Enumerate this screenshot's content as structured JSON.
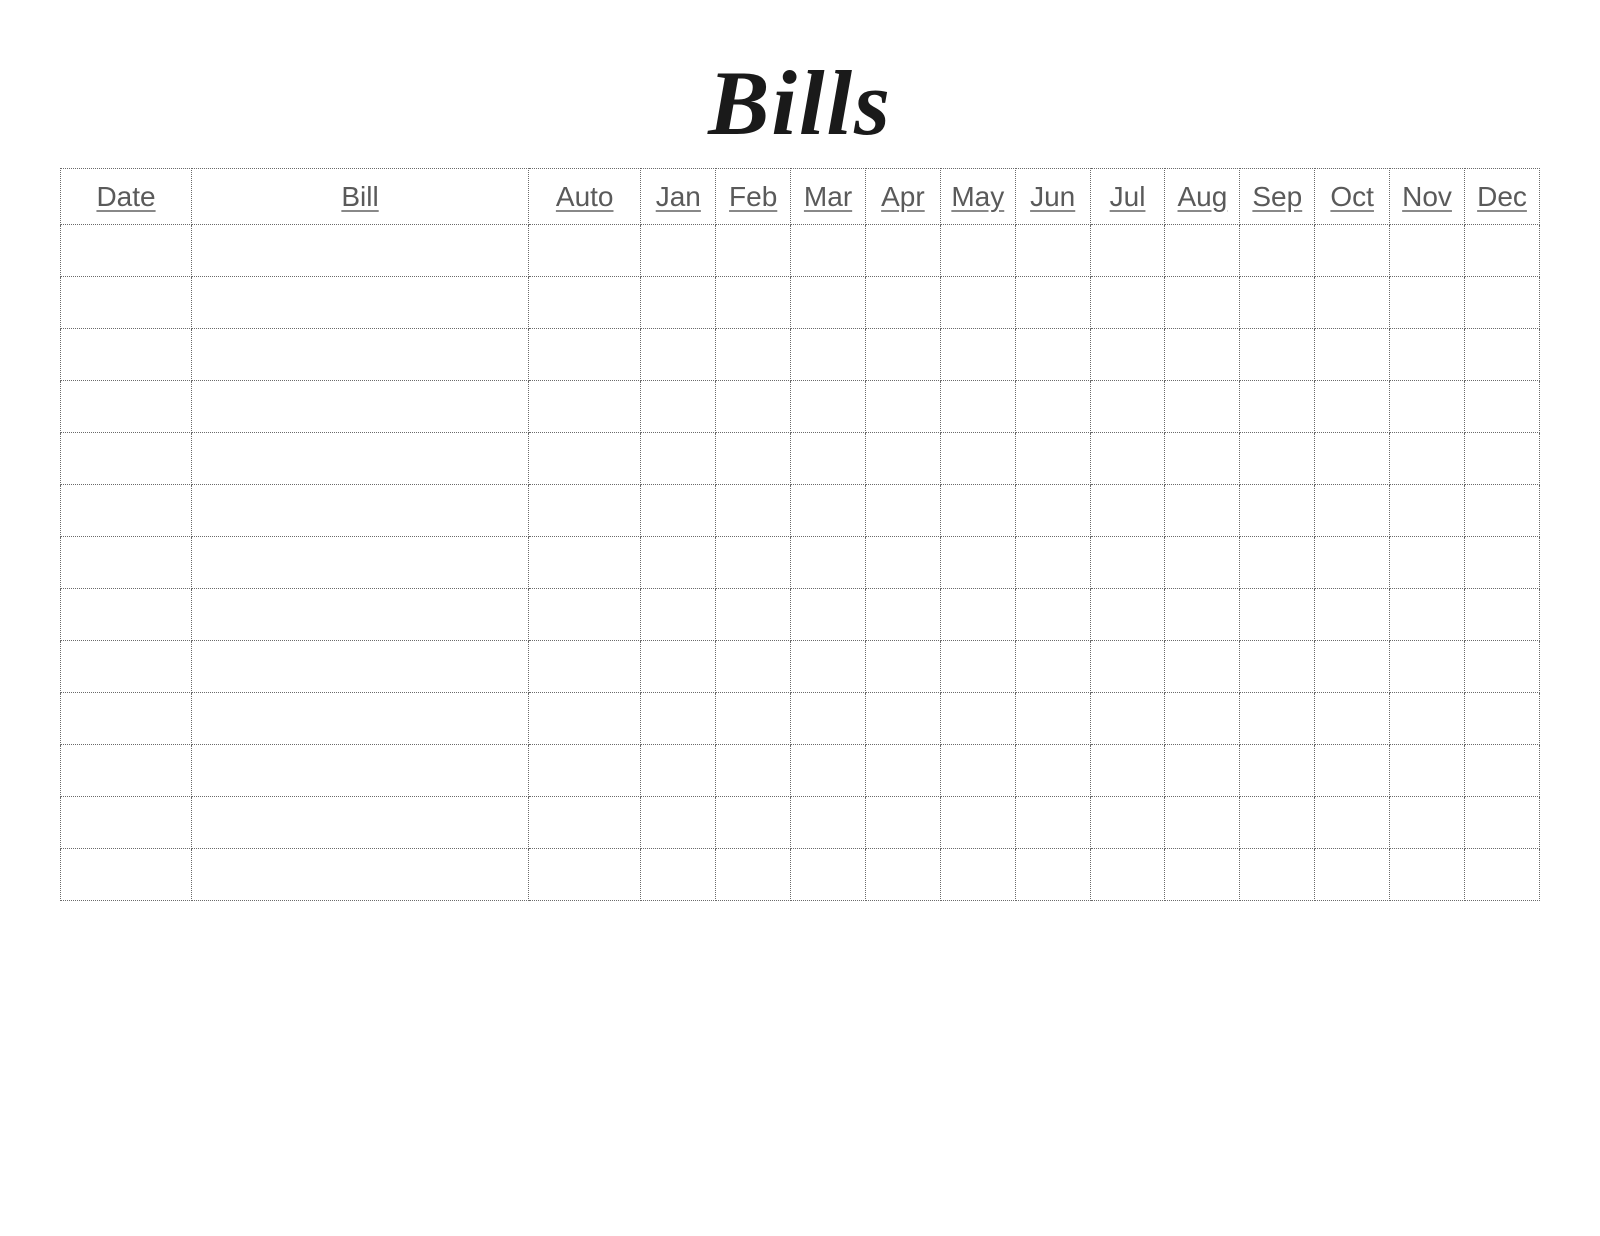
{
  "title": "Bills",
  "headers": {
    "date": "Date",
    "bill": "Bill",
    "auto": "Auto",
    "months": [
      "Jan",
      "Feb",
      "Mar",
      "Apr",
      "May",
      "Jun",
      "Jul",
      "Aug",
      "Sep",
      "Oct",
      "Nov",
      "Dec"
    ]
  },
  "rowCount": 13
}
